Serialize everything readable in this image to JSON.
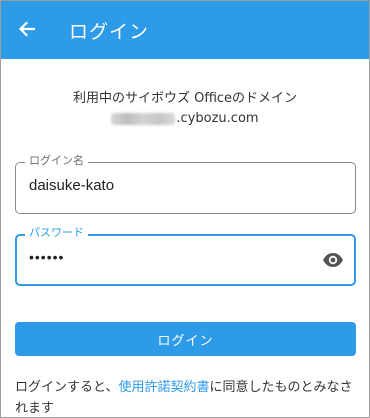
{
  "appbar": {
    "title": "ログイン",
    "back_icon": "arrow-left-icon"
  },
  "domain": {
    "heading": "利用中のサイボウズ Officeのドメイン",
    "suffix": ".cybozu.com"
  },
  "username": {
    "label": "ログイン名",
    "value": "daisuke-kato"
  },
  "password": {
    "label": "パスワード",
    "masked_value": "••••••",
    "toggle_icon": "eye-icon"
  },
  "login_button": {
    "label": "ログイン"
  },
  "terms": {
    "prefix": "ログインすると、",
    "link": "使用許諾契約書",
    "suffix": "に同意したものとみなされます"
  },
  "colors": {
    "accent": "#2d9be8",
    "text": "#333333",
    "background": "#ffffff"
  }
}
